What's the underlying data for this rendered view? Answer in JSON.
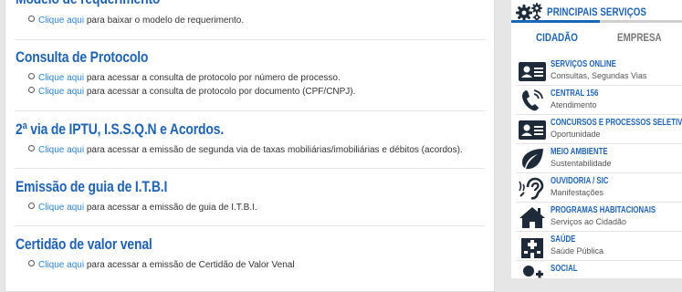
{
  "main": {
    "sections": [
      {
        "title": "Modelo de requerimento",
        "lines": [
          {
            "link": "Clique aqui",
            "text": " para baixar o modelo de requerimento."
          }
        ]
      },
      {
        "title": "Consulta de Protocolo",
        "lines": [
          {
            "link": "Clique aqui",
            "text": " para acessar a consulta de protocolo por número de processo."
          },
          {
            "link": "Clique aqui",
            "text": " para acessar a consulta de protocolo por documento (CPF/CNPJ)."
          }
        ]
      },
      {
        "title": "2ª via de IPTU, I.S.S.Q.N e Acordos.",
        "lines": [
          {
            "link": "Clique aqui",
            "text": " para acessar a emissão de segunda via de taxas mobiliárias/imobiliárias e débitos (acordos)."
          }
        ]
      },
      {
        "title": "Emissão de guia de I.T.B.I",
        "lines": [
          {
            "link": "Clique aqui",
            "text": " para acessar a emissão de guia de I.T.B.I."
          }
        ]
      },
      {
        "title": "Certidão de valor venal",
        "lines": [
          {
            "link": "Clique aqui",
            "text": " para acessar a emissão de Certidão de Valor Venal"
          }
        ]
      }
    ]
  },
  "sidebar": {
    "title": "PRINCIPAIS SERVIÇOS",
    "tabs": [
      {
        "label": "CIDADÃO"
      },
      {
        "label": "EMPRESA"
      }
    ],
    "items": [
      {
        "name": "SERVIÇOS ONLINE",
        "desc": "Consultas, Segundas Vias",
        "icon": "id-card-icon"
      },
      {
        "name": "CENTRAL 156",
        "desc": "Atendimento",
        "icon": "phone-icon"
      },
      {
        "name": "CONCURSOS E PROCESSOS SELETIVOS",
        "desc": "Oportunidade",
        "icon": "id-card-icon"
      },
      {
        "name": "MEIO AMBIENTE",
        "desc": "Sustentabilidade",
        "icon": "leaf-icon"
      },
      {
        "name": "OUVIDORIA / SIC",
        "desc": "Manifestações",
        "icon": "ear-icon"
      },
      {
        "name": "PROGRAMAS HABITACIONAIS",
        "desc": "Serviços ao Cidadão",
        "icon": "house-icon"
      },
      {
        "name": "SAÚDE",
        "desc": "Saúde Pública",
        "icon": "hospital-icon"
      },
      {
        "name": "SOCIAL",
        "desc": "",
        "icon": "people-icon"
      }
    ]
  },
  "colors": {
    "accent": "#2163b0",
    "link": "#2f83cf",
    "icon": "#1e2a3a"
  }
}
